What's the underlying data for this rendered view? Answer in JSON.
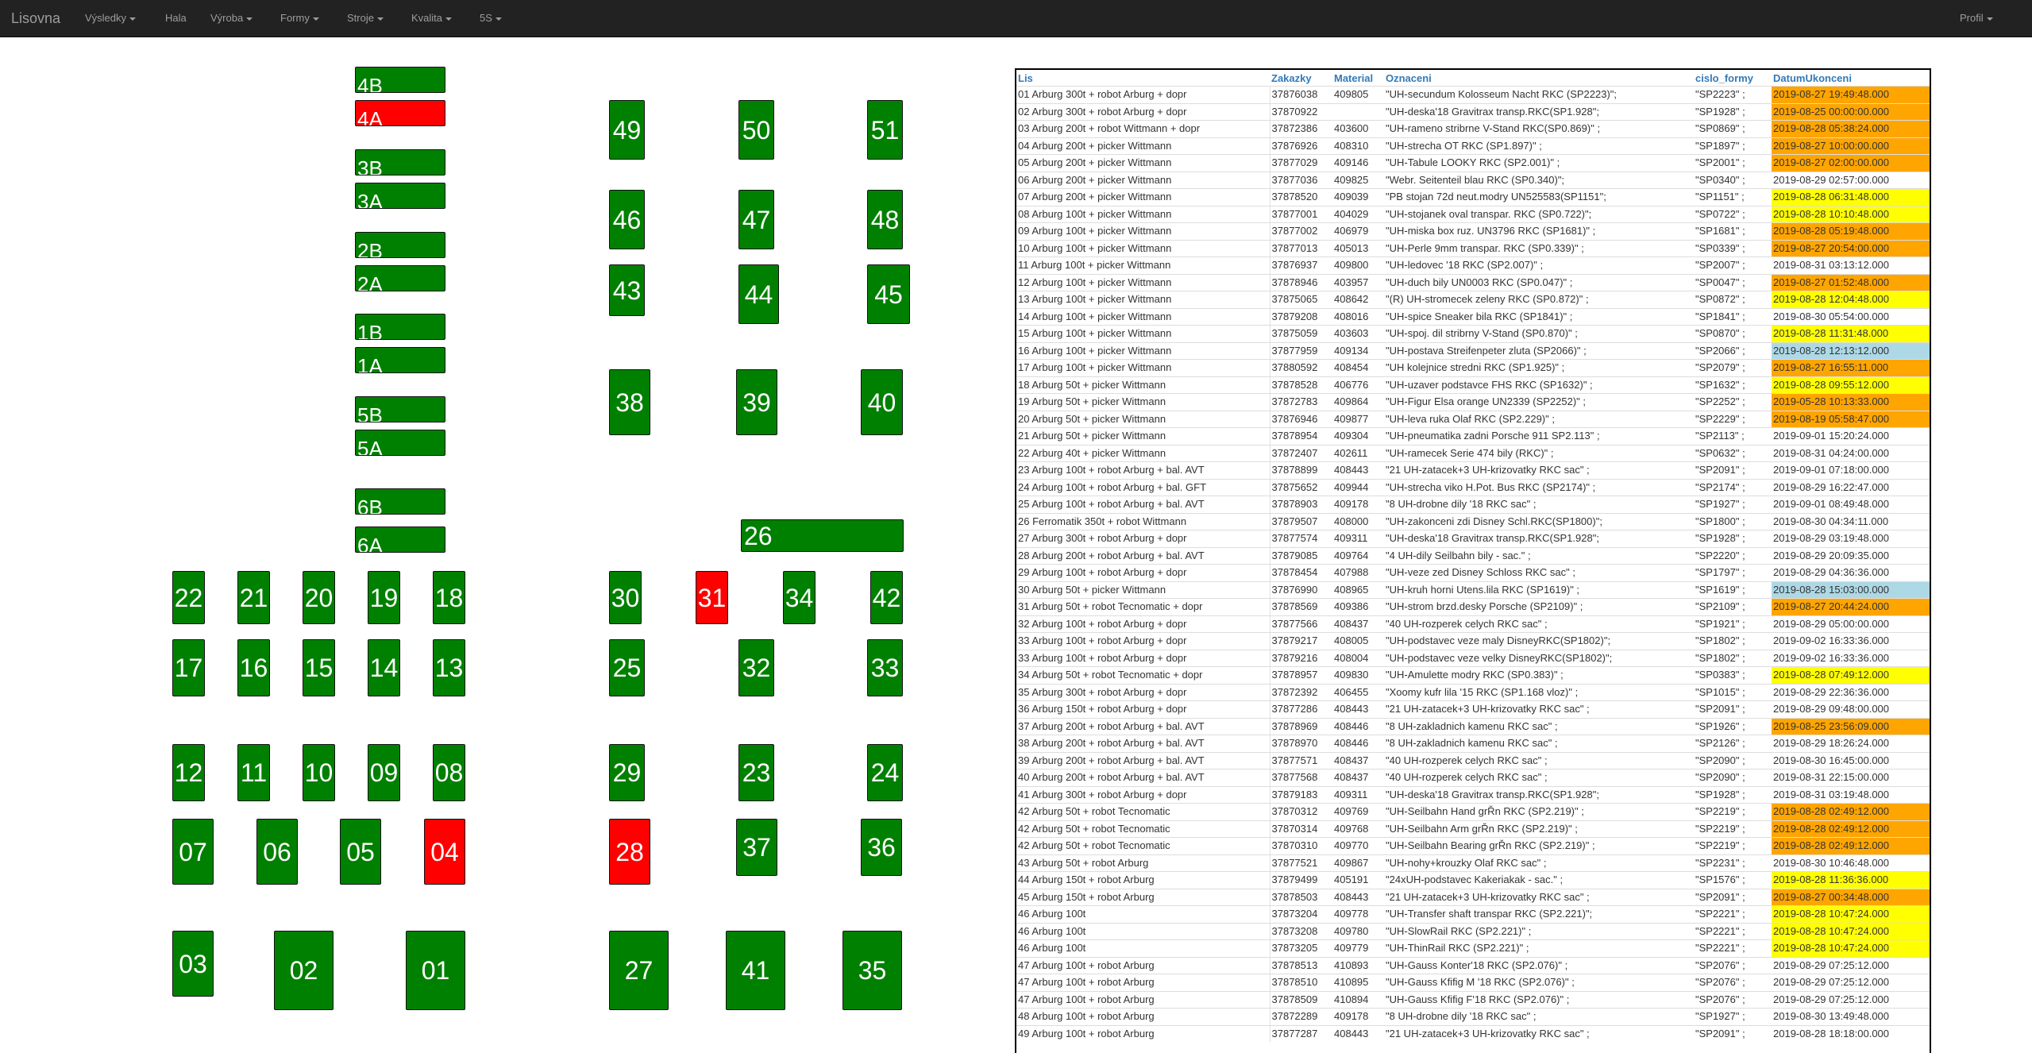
{
  "navbar": {
    "brand": "Lisovna",
    "menu": [
      {
        "label": "Výsledky",
        "dropdown": true
      },
      {
        "label": "Hala",
        "dropdown": false
      },
      {
        "label": "Výroba",
        "dropdown": true
      },
      {
        "label": "Formy",
        "dropdown": true
      },
      {
        "label": "Stroje",
        "dropdown": true
      },
      {
        "label": "Kvalita",
        "dropdown": true
      },
      {
        "label": "5S",
        "dropdown": true
      }
    ],
    "profile": {
      "label": "Profil",
      "dropdown": true
    }
  },
  "colors": {
    "ok": "#008000",
    "alarm": "#ff0000",
    "orange": "#ffa500",
    "yellow": "#ffff00",
    "lightblue": "#add8e6"
  },
  "machines": [
    {
      "id": "4B",
      "status": "ok"
    },
    {
      "id": "4A",
      "status": "alarm"
    },
    {
      "id": "3B",
      "status": "ok"
    },
    {
      "id": "3A",
      "status": "ok"
    },
    {
      "id": "2B",
      "status": "ok"
    },
    {
      "id": "2A",
      "status": "ok"
    },
    {
      "id": "1B",
      "status": "ok"
    },
    {
      "id": "1A",
      "status": "ok"
    },
    {
      "id": "5B",
      "status": "ok"
    },
    {
      "id": "5A",
      "status": "ok"
    },
    {
      "id": "6B",
      "status": "ok"
    },
    {
      "id": "6A",
      "status": "ok"
    },
    {
      "id": "49",
      "status": "ok"
    },
    {
      "id": "50",
      "status": "ok"
    },
    {
      "id": "51",
      "status": "ok"
    },
    {
      "id": "46",
      "status": "ok"
    },
    {
      "id": "47",
      "status": "ok"
    },
    {
      "id": "48",
      "status": "ok"
    },
    {
      "id": "43",
      "status": "ok"
    },
    {
      "id": "44",
      "status": "ok"
    },
    {
      "id": "45",
      "status": "ok"
    },
    {
      "id": "38",
      "status": "ok"
    },
    {
      "id": "39",
      "status": "ok"
    },
    {
      "id": "40",
      "status": "ok"
    },
    {
      "id": "26",
      "status": "ok"
    },
    {
      "id": "22",
      "status": "ok"
    },
    {
      "id": "21",
      "status": "ok"
    },
    {
      "id": "20",
      "status": "ok"
    },
    {
      "id": "19",
      "status": "ok"
    },
    {
      "id": "18",
      "status": "ok"
    },
    {
      "id": "30",
      "status": "ok"
    },
    {
      "id": "31",
      "status": "alarm"
    },
    {
      "id": "34",
      "status": "ok"
    },
    {
      "id": "42",
      "status": "ok"
    },
    {
      "id": "17",
      "status": "ok"
    },
    {
      "id": "16",
      "status": "ok"
    },
    {
      "id": "15",
      "status": "ok"
    },
    {
      "id": "14",
      "status": "ok"
    },
    {
      "id": "13",
      "status": "ok"
    },
    {
      "id": "25",
      "status": "ok"
    },
    {
      "id": "32",
      "status": "ok"
    },
    {
      "id": "33",
      "status": "ok"
    },
    {
      "id": "12",
      "status": "ok"
    },
    {
      "id": "11",
      "status": "ok"
    },
    {
      "id": "10",
      "status": "ok"
    },
    {
      "id": "09",
      "status": "ok"
    },
    {
      "id": "08",
      "status": "ok"
    },
    {
      "id": "29",
      "status": "ok"
    },
    {
      "id": "23",
      "status": "ok"
    },
    {
      "id": "24",
      "status": "ok"
    },
    {
      "id": "07",
      "status": "ok"
    },
    {
      "id": "06",
      "status": "ok"
    },
    {
      "id": "05",
      "status": "ok"
    },
    {
      "id": "04",
      "status": "alarm"
    },
    {
      "id": "28",
      "status": "alarm"
    },
    {
      "id": "37",
      "status": "ok"
    },
    {
      "id": "36",
      "status": "ok"
    },
    {
      "id": "03",
      "status": "ok"
    },
    {
      "id": "02",
      "status": "ok"
    },
    {
      "id": "01",
      "status": "ok"
    },
    {
      "id": "27",
      "status": "ok"
    },
    {
      "id": "41",
      "status": "ok"
    },
    {
      "id": "35",
      "status": "ok"
    }
  ],
  "table": {
    "headers": [
      "Lis",
      "Zakazky",
      "Material",
      "Oznaceni",
      "cislo_formy",
      "DatumUkonceni"
    ],
    "rows": [
      [
        "01 Arburg 300t + robot Arburg + dopr",
        "37876038",
        "409805",
        "\"UH-secundum Kolosseum Nacht RKC (SP2223)\";",
        "\"SP2223\" ;",
        "2019-08-27 19:49:48.000",
        "orange"
      ],
      [
        "02 Arburg 300t + robot Arburg + dopr",
        "37870922",
        "",
        "\"UH-deska'18 Gravitrax transp.RKC(SP1.928\";",
        "\"SP1928\" ;",
        "2019-08-25 00:00:00.000",
        "orange"
      ],
      [
        "03 Arburg 200t + robot Wittmann + dopr",
        "37872386",
        "403600",
        "\"UH-rameno stribrne V-Stand RKC(SP0.869)\" ;",
        "\"SP0869\" ;",
        "2019-08-28 05:38:24.000",
        "orange"
      ],
      [
        "04 Arburg 200t + picker Wittmann",
        "37876926",
        "408310",
        "\"UH-strecha OT RKC (SP1.897)\" ;",
        "\"SP1897\" ;",
        "2019-08-27 10:00:00.000",
        "orange"
      ],
      [
        "05 Arburg 200t + picker Wittmann",
        "37877029",
        "409146",
        "\"UH-Tabule LOOKY RKC (SP2.001)\" ;",
        "\"SP2001\" ;",
        "2019-08-27 02:00:00.000",
        "orange"
      ],
      [
        "06 Arburg 200t + picker Wittmann",
        "37877036",
        "409825",
        "\"Webr. Seitenteil blau RKC (SP0.340)\";",
        "\"SP0340\" ;",
        "2019-08-29 02:57:00.000",
        ""
      ],
      [
        "07 Arburg 200t + picker Wittmann",
        "37878520",
        "409039",
        "\"PB stojan 72d neut.modry UN525583(SP1151\";",
        "\"SP1151\" ;",
        "2019-08-28 06:31:48.000",
        "yellow"
      ],
      [
        "08 Arburg 100t + picker Wittmann",
        "37877001",
        "404029",
        "\"UH-stojanek oval transpar. RKC (SP0.722)\";",
        "\"SP0722\" ;",
        "2019-08-28 10:10:48.000",
        "yellow"
      ],
      [
        "09 Arburg 100t + picker Wittmann",
        "37877002",
        "406979",
        "\"UH-miska box ruz. UN3796 RKC (SP1681)\" ;",
        "\"SP1681\" ;",
        "2019-08-28 05:19:48.000",
        "orange"
      ],
      [
        "10 Arburg 100t + picker Wittmann",
        "37877013",
        "405013",
        "\"UH-Perle 9mm transpar. RKC (SP0.339)\" ;",
        "\"SP0339\" ;",
        "2019-08-27 20:54:00.000",
        "orange"
      ],
      [
        "11 Arburg 100t + picker Wittmann",
        "37876937",
        "409800",
        "\"UH-ledovec '18 RKC (SP2.007)\" ;",
        "\"SP2007\" ;",
        "2019-08-31 03:13:12.000",
        ""
      ],
      [
        "12 Arburg 100t + picker Wittmann",
        "37878946",
        "403957",
        "\"UH-duch bily UN0003 RKC (SP0.047)\" ;",
        "\"SP0047\" ;",
        "2019-08-27 01:52:48.000",
        "orange"
      ],
      [
        "13 Arburg 100t + picker Wittmann",
        "37875065",
        "408642",
        "\"(R) UH-stromecek zeleny RKC (SP0.872)\" ;",
        "\"SP0872\" ;",
        "2019-08-28 12:04:48.000",
        "yellow"
      ],
      [
        "14 Arburg 100t + picker Wittmann",
        "37879208",
        "408016",
        "\"UH-spice Sneaker bila RKC (SP1841)\" ;",
        "\"SP1841\" ;",
        "2019-08-30 05:54:00.000",
        ""
      ],
      [
        "15 Arburg 100t + picker Wittmann",
        "37875059",
        "403603",
        "\"UH-spoj. dil stribrny V-Stand (SP0.870)\" ;",
        "\"SP0870\" ;",
        "2019-08-28 11:31:48.000",
        "yellow"
      ],
      [
        "16 Arburg 100t + picker Wittmann",
        "37877959",
        "409134",
        "\"UH-postava Streifenpeter zluta (SP2066)\" ;",
        "\"SP2066\" ;",
        "2019-08-28 12:13:12.000",
        "lightblue"
      ],
      [
        "17 Arburg 100t + picker Wittmann",
        "37880592",
        "408454",
        "\"UH kolejnice stredni RKC (SP1.925)\" ;",
        "\"SP2079\" ;",
        "2019-08-27 16:55:11.000",
        "orange"
      ],
      [
        "18 Arburg 50t + picker Wittmann",
        "37878528",
        "406776",
        "\"UH-uzaver podstavce FHS RKC (SP1632)\" ;",
        "\"SP1632\" ;",
        "2019-08-28 09:55:12.000",
        "yellow"
      ],
      [
        "19 Arburg 50t + picker Wittmann",
        "37872783",
        "409864",
        "\"UH-Figur Elsa orange UN2339 (SP2252)\" ;",
        "\"SP2252\" ;",
        "2019-05-28 10:13:33.000",
        "orange"
      ],
      [
        "20 Arburg 50t + picker Wittmann",
        "37876946",
        "409877",
        "\"UH-leva ruka Olaf RKC (SP2.229)\" ;",
        "\"SP2229\" ;",
        "2019-08-19 05:58:47.000",
        "orange"
      ],
      [
        "21 Arburg 50t + picker Wittmann",
        "37878954",
        "409304",
        "\"UH-pneumatika zadni Porsche 911 SP2.113\" ;",
        "\"SP2113\" ;",
        "2019-09-01 15:20:24.000",
        ""
      ],
      [
        "22 Arburg 40t + picker Wittmann",
        "37872407",
        "402611",
        "\"UH-ramecek Serie 474 bily (RKC)\" ;",
        "\"SP0632\" ;",
        "2019-08-31 04:24:00.000",
        ""
      ],
      [
        "23 Arburg 100t + robot Arburg + bal. AVT",
        "37878899",
        "408443",
        "\"21 UH-zatacek+3 UH-krizovatky RKC sac\" ;",
        "\"SP2091\" ;",
        "2019-09-01 07:18:00.000",
        ""
      ],
      [
        "24 Arburg 100t + robot Arburg + bal. GFT",
        "37875652",
        "409944",
        "\"UH-strecha viko H.Pot. Bus RKC (SP2174)\" ;",
        "\"SP2174\" ;",
        "2019-08-29 16:22:47.000",
        ""
      ],
      [
        "25 Arburg 100t + robot Arburg + bal. AVT",
        "37878903",
        "409178",
        "\"8 UH-drobne dily '18 RKC sac\" ;",
        "\"SP1927\" ;",
        "2019-09-01 08:49:48.000",
        ""
      ],
      [
        "26 Ferromatik 350t + robot Wittmann",
        "37879507",
        "408000",
        "\"UH-zakonceni zdi Disney Schl.RKC(SP1800)\";",
        "\"SP1800\" ;",
        "2019-08-30 04:34:11.000",
        ""
      ],
      [
        "27 Arburg 300t + robot Arburg + dopr",
        "37877574",
        "409311",
        "\"UH-deska'18 Gravitrax transp.RKC(SP1.928\";",
        "\"SP1928\" ;",
        "2019-08-29 03:19:48.000",
        ""
      ],
      [
        "28 Arburg 200t + robot Arburg + bal. AVT",
        "37879085",
        "409764",
        "\"4 UH-dily Seilbahn bily - sac.\" ;",
        "\"SP2220\" ;",
        "2019-08-29 20:09:35.000",
        ""
      ],
      [
        "29 Arburg 100t + robot Arburg + dopr",
        "37878454",
        "407988",
        "\"UH-veze zed Disney Schloss RKC sac\" ;",
        "\"SP1797\" ;",
        "2019-08-29 04:36:36.000",
        ""
      ],
      [
        "30 Arburg 50t + picker Wittmann",
        "37876990",
        "408965",
        "\"UH-kruh horni Utens.lila RKC (SP1619)\" ;",
        "\"SP1619\" ;",
        "2019-08-28 15:03:00.000",
        "lightblue"
      ],
      [
        "31 Arburg 50t + robot Tecnomatic + dopr",
        "37878569",
        "409386",
        "\"UH-strom brzd.desky Porsche (SP2109)\" ;",
        "\"SP2109\" ;",
        "2019-08-27 20:44:24.000",
        "orange"
      ],
      [
        "32 Arburg 100t + robot Arburg + dopr",
        "37877566",
        "408437",
        "\"40 UH-rozperek celych RKC sac\" ;",
        "\"SP1921\" ;",
        "2019-08-29 05:00:00.000",
        ""
      ],
      [
        "33 Arburg 100t + robot Arburg + dopr",
        "37879217",
        "408005",
        "\"UH-podstavec veze maly DisneyRKC(SP1802)\";",
        "\"SP1802\" ;",
        "2019-09-02 16:33:36.000",
        ""
      ],
      [
        "33 Arburg 100t + robot Arburg + dopr",
        "37879216",
        "408004",
        "\"UH-podstavec veze velky DisneyRKC(SP1802)\";",
        "\"SP1802\" ;",
        "2019-09-02 16:33:36.000",
        ""
      ],
      [
        "34 Arburg 50t + robot Tecnomatic + dopr",
        "37878957",
        "409830",
        "\"UH-Amulette modry RKC (SP0.383)\" ;",
        "\"SP0383\" ;",
        "2019-08-28 07:49:12.000",
        "yellow"
      ],
      [
        "35 Arburg 300t + robot Arburg + dopr",
        "37872392",
        "406455",
        "\"Xoomy kufr lila '15 RKC (SP1.168 vloz)\" ;",
        "\"SP1015\" ;",
        "2019-08-29 22:36:36.000",
        ""
      ],
      [
        "36 Arburg 150t + robot Arburg + dopr",
        "37877286",
        "408443",
        "\"21 UH-zatacek+3 UH-krizovatky RKC sac\" ;",
        "\"SP2091\" ;",
        "2019-08-29 09:48:00.000",
        ""
      ],
      [
        "37 Arburg 200t + robot Arburg + bal. AVT",
        "37878969",
        "408446",
        "\"8 UH-zakladnich kamenu RKC sac\" ;",
        "\"SP1926\" ;",
        "2019-08-25 23:56:09.000",
        "orange"
      ],
      [
        "38 Arburg 200t + robot Arburg + bal. AVT",
        "37878970",
        "408446",
        "\"8 UH-zakladnich kamenu RKC sac\" ;",
        "\"SP2126\" ;",
        "2019-08-29 18:26:24.000",
        ""
      ],
      [
        "39 Arburg 200t + robot Arburg + bal. AVT",
        "37877571",
        "408437",
        "\"40 UH-rozperek celych RKC sac\" ;",
        "\"SP2090\" ;",
        "2019-08-30 16:45:00.000",
        ""
      ],
      [
        "40 Arburg 200t + robot Arburg + bal. AVT",
        "37877568",
        "408437",
        "\"40 UH-rozperek celych RKC sac\" ;",
        "\"SP2090\" ;",
        "2019-08-31 22:15:00.000",
        ""
      ],
      [
        "41 Arburg 300t + robot Arburg + dopr",
        "37879183",
        "409311",
        "\"UH-deska'18 Gravitrax transp.RKC(SP1.928\";",
        "\"SP1928\" ;",
        "2019-08-31 03:19:48.000",
        ""
      ],
      [
        "42 Arburg 50t + robot Tecnomatic",
        "37870312",
        "409769",
        "\"UH-Seilbahn Hand grŘn RKC (SP2.219)\" ;",
        "\"SP2219\" ;",
        "2019-08-28 02:49:12.000",
        "orange"
      ],
      [
        "42 Arburg 50t + robot Tecnomatic",
        "37870314",
        "409768",
        "\"UH-Seilbahn Arm grŘn RKC (SP2.219)\" ;",
        "\"SP2219\" ;",
        "2019-08-28 02:49:12.000",
        "orange"
      ],
      [
        "42 Arburg 50t + robot Tecnomatic",
        "37870310",
        "409770",
        "\"UH-Seilbahn Bearing grŘn RKC (SP2.219)\" ;",
        "\"SP2219\" ;",
        "2019-08-28 02:49:12.000",
        "orange"
      ],
      [
        "43 Arburg 50t + robot Arburg",
        "37877521",
        "409867",
        "\"UH-nohy+krouzky Olaf RKC sac\" ;",
        "\"SP2231\" ;",
        "2019-08-30 10:46:48.000",
        ""
      ],
      [
        "44 Arburg 150t + robot Arburg",
        "37879499",
        "405191",
        "\"24xUH-podstavec Kakeriakak - sac.\" ;",
        "\"SP1576\" ;",
        "2019-08-28 11:36:36.000",
        "yellow"
      ],
      [
        "45 Arburg 150t + robot Arburg",
        "37878503",
        "408443",
        "\"21 UH-zatacek+3 UH-krizovatky RKC sac\" ;",
        "\"SP2091\" ;",
        "2019-08-27 00:34:48.000",
        "orange"
      ],
      [
        "46 Arburg 100t",
        "37873204",
        "409778",
        "\"UH-Transfer shaft transpar RKC (SP2.221)\";",
        "\"SP2221\" ;",
        "2019-08-28 10:47:24.000",
        "yellow"
      ],
      [
        "46 Arburg 100t",
        "37873208",
        "409780",
        "\"UH-SlowRail RKC (SP2.221)\" ;",
        "\"SP2221\" ;",
        "2019-08-28 10:47:24.000",
        "yellow"
      ],
      [
        "46 Arburg 100t",
        "37873205",
        "409779",
        "\"UH-ThinRail RKC (SP2.221)\" ;",
        "\"SP2221\" ;",
        "2019-08-28 10:47:24.000",
        "yellow"
      ],
      [
        "47 Arburg 100t + robot Arburg",
        "37878513",
        "410893",
        "\"UH-Gauss Konter'18 RKC (SP2.076)\" ;",
        "\"SP2076\" ;",
        "2019-08-29 07:25:12.000",
        ""
      ],
      [
        "47 Arburg 100t + robot Arburg",
        "37878510",
        "410895",
        "\"UH-Gauss Kfifig M '18 RKC (SP2.076)\" ;",
        "\"SP2076\" ;",
        "2019-08-29 07:25:12.000",
        ""
      ],
      [
        "47 Arburg 100t + robot Arburg",
        "37878509",
        "410894",
        "\"UH-Gauss Kfifig F'18 RKC (SP2.076)\" ;",
        "\"SP2076\" ;",
        "2019-08-29 07:25:12.000",
        ""
      ],
      [
        "48 Arburg 100t + robot Arburg",
        "37872289",
        "409178",
        "\"8 UH-drobne dily '18 RKC sac\" ;",
        "\"SP1927\" ;",
        "2019-08-30 13:49:48.000",
        ""
      ],
      [
        "49 Arburg 100t + robot Arburg",
        "37877287",
        "408443",
        "\"21 UH-zatacek+3 UH-krizovatky RKC sac\" ;",
        "\"SP2091\" ;",
        "2019-08-28 18:18:00.000",
        ""
      ]
    ]
  }
}
